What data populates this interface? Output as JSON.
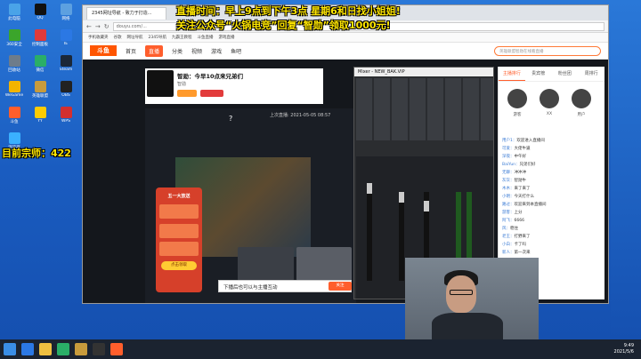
{
  "overlay": {
    "line1": "直播时间：早上9点到下午3点 星期6和日找小姐姐!",
    "line2": "关注公众号“火锅电竞”回复“智勋”领取1000元!",
    "counter": "目前宗师：422",
    "color_yellow": "#ffe600"
  },
  "desktop_icons": [
    {
      "label": "此电脑",
      "color": "#4aa3e8"
    },
    {
      "label": "QQ",
      "color": "#111111"
    },
    {
      "label": "网络",
      "color": "#5da0e0"
    },
    {
      "label": "360安全",
      "color": "#3ba52b"
    },
    {
      "label": "控制面板",
      "color": "#e03a3a"
    },
    {
      "label": "IE",
      "color": "#2b78e4"
    },
    {
      "label": "回收站",
      "color": "#6e7c8a"
    },
    {
      "label": "微信",
      "color": "#2aae67"
    },
    {
      "label": "Steam",
      "color": "#1b2838"
    },
    {
      "label": "WeGame",
      "color": "#f2b400"
    },
    {
      "label": "英雄联盟",
      "color": "#c89b3c"
    },
    {
      "label": "OBS",
      "color": "#222222"
    },
    {
      "label": "斗鱼",
      "color": "#ff5e2c"
    },
    {
      "label": "YY",
      "color": "#ffcc00"
    },
    {
      "label": "WPS",
      "color": "#d32f2f"
    },
    {
      "label": "浏览器",
      "color": "#3ab0ff"
    }
  ],
  "browser": {
    "tab_title": "2345网址导航 - 致力于打造...",
    "url": "douyu.com/...",
    "bookmarks": [
      "手机收藏夹",
      "谷歌",
      "网址导航",
      "2345导航",
      "九霸王教程",
      "斗鱼直播",
      "游戏直播"
    ],
    "site_nav": {
      "logo": "斗鱼",
      "items": [
        "首页",
        "直播",
        "分类",
        "视频",
        "游戏",
        "鱼吧"
      ],
      "active": "直播",
      "search_placeholder": "英雄联盟智勋在线看直播"
    }
  },
  "room": {
    "title": "智勋：今早10点来兄弟们",
    "streamer": "智勋",
    "live_time": "上次直播: 2021-05-05 08:57",
    "banner_text": "下播后也可以与主播互动",
    "follow_label": "关注",
    "player_question": "?",
    "popup_title": "五一大放送",
    "popup_button": "点击领取"
  },
  "mixer": {
    "title": "Mixer - NEW_BAK.VIP"
  },
  "chat": {
    "tabs": [
      "主播排行",
      "贵宾榜",
      "粉丝团",
      "周排行"
    ],
    "active_tab": "主播排行",
    "fans": [
      "游客",
      "XX",
      "用户"
    ],
    "messages": [
      {
        "user": "用户1",
        "text": "欢迎进入直播间"
      },
      {
        "user": "可爱",
        "text": "大佬牛逼"
      },
      {
        "user": "深夜",
        "text": "中午好"
      },
      {
        "user": "BaiYun",
        "text": "兄弟们好"
      },
      {
        "user": "无聊",
        "text": "冲冲冲"
      },
      {
        "user": "灰灰",
        "text": "智勋牛"
      },
      {
        "user": "木木",
        "text": "来了来了"
      },
      {
        "user": "小明",
        "text": "今天打什么"
      },
      {
        "user": "路过",
        "text": "欢迎来到本直播间"
      },
      {
        "user": "游客",
        "text": "上分"
      },
      {
        "user": "阿飞",
        "text": "6666"
      },
      {
        "user": "风",
        "text": "稳住"
      },
      {
        "user": "老王",
        "text": "打野来了"
      },
      {
        "user": "小白",
        "text": "卡了吗"
      },
      {
        "user": "新人",
        "text": "第一次来"
      },
      {
        "user": "粉丝",
        "text": "关注了"
      }
    ]
  },
  "taskbar": {
    "time": "9:49",
    "date": "2021/5/6"
  }
}
